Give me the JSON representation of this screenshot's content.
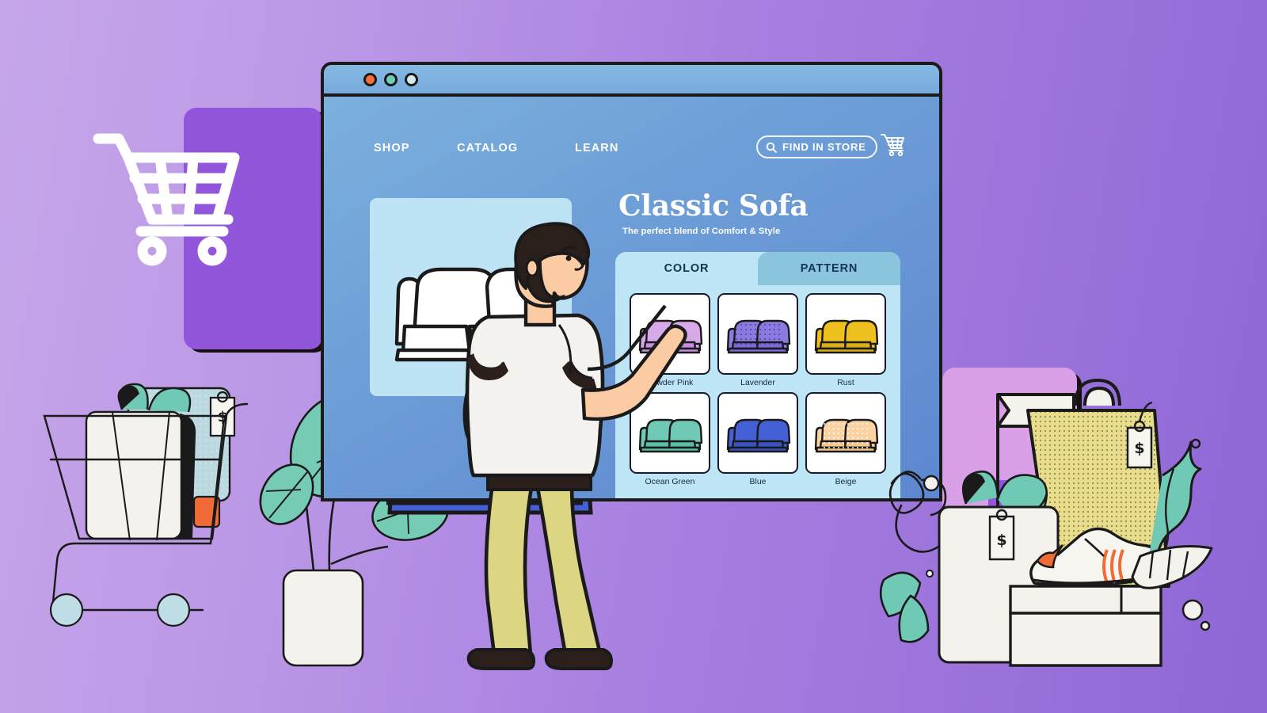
{
  "scene": {
    "kind": "e-commerce-furniture-configurator-illustration",
    "background_gradient_from": "#c6a6ea",
    "background_gradient_to": "#8f67d6"
  },
  "window": {
    "traffic_lights": [
      {
        "name": "close-dot",
        "color": "#f2703c"
      },
      {
        "name": "minimize-dot",
        "color": "#6ecdb8"
      },
      {
        "name": "maximize-dot",
        "color": "#d5e9ed"
      }
    ],
    "chrome_border": "#1a1a1a",
    "page_bg_top": "#7cb0dd",
    "page_bg_bottom": "#5d87cf"
  },
  "nav": {
    "links": [
      {
        "label": "SHOP",
        "name": "nav-shop"
      },
      {
        "label": "CATALOG",
        "name": "nav-catalog"
      },
      {
        "label": "LEARN",
        "name": "nav-learn"
      }
    ],
    "find_in_store": {
      "label": "FIND IN STORE",
      "icon": "search-icon"
    },
    "cart_icon": "shopping-cart-icon"
  },
  "product": {
    "title": "Classic Sofa",
    "subtitle": "The perfect blend of Comfort & Style",
    "hero_image_alt": "white-sofa-line-drawing",
    "hero_panel_color": "#bde3f5"
  },
  "options": {
    "panel_color": "#bde5f6",
    "tabs": [
      {
        "label": "COLOR",
        "name": "tab-color",
        "active": true
      },
      {
        "label": "PATTERN",
        "name": "tab-pattern",
        "active": false
      }
    ],
    "swatches": [
      {
        "label": "Powder Pink",
        "fill": "#d7a9e8",
        "shade": "#c48ddd",
        "pattern": "none",
        "pointed_at": true
      },
      {
        "label": "Lavender",
        "fill": "#8b7ae0",
        "shade": "#7b68da",
        "pattern": "dots",
        "pointed_at": false
      },
      {
        "label": "Rust",
        "fill": "#eec01e",
        "shade": "#dcae10",
        "pattern": "none",
        "pointed_at": false
      },
      {
        "label": "Ocean Green",
        "fill": "#6fc9b4",
        "shade": "#5bbda5",
        "pattern": "none",
        "pointed_at": false
      },
      {
        "label": "Blue",
        "fill": "#4460d4",
        "shade": "#3a53c4",
        "pattern": "none",
        "pointed_at": false
      },
      {
        "label": "Beige",
        "fill": "#fbd3a3",
        "shade": "#f6c68d",
        "pattern": "dots",
        "pointed_at": false
      }
    ]
  },
  "decor": {
    "left_cart_icon": "shopping-cart-icon",
    "left_trolley": {
      "name": "shopping-trolley",
      "gift_box_color": "#f4f2ec",
      "ribbon_color": "#6fc9b4",
      "price_tag_symbol": "$",
      "card_color": "#bcd9e2",
      "accent_color": "#ef6c38",
      "wheel_color": "#bfdde5"
    },
    "plant_left": {
      "name": "potted-plant",
      "leaf_color": "#76cbb5",
      "pot_color": "#f4f2ec"
    },
    "blue_sofa": {
      "name": "blue-sofa",
      "color": "#4460d4"
    },
    "right_cluster": {
      "shopping_bag_color": "#e8dd8c",
      "gift_box_color": "#f4f2ec",
      "ribbon_color": "#6fc9b4",
      "shoe_box_color": "#f4f2ec",
      "sneaker_color": "#f7f5f0",
      "sneaker_stripe": "#ef6c38",
      "flag_color": "#f4f2ec",
      "leaf_color": "#6fc9b4",
      "price_tag_symbol": "$"
    }
  },
  "person": {
    "name": "shopper-man",
    "shirt_color": "#f4f2ee",
    "pants_color": "#dcd584",
    "skin_color": "#fbcba4",
    "hair_color": "#2b1f1c",
    "shoe_color": "#2b1f1c",
    "pose": "pointing-at-powder-pink-swatch"
  }
}
